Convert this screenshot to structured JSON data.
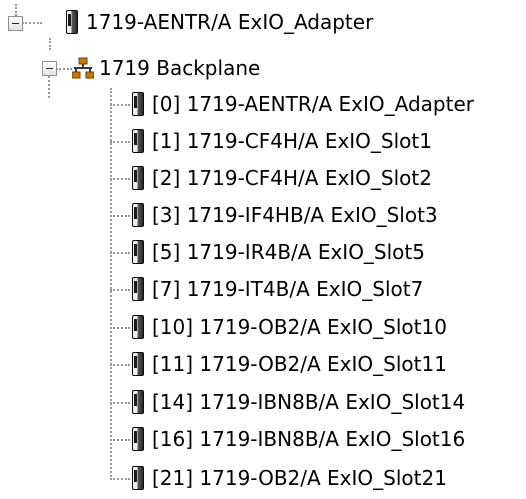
{
  "tree": {
    "root": {
      "label": "1719-AENTR/A ExIO_Adapter",
      "icon": "module-icon",
      "expanded": true
    },
    "backplane": {
      "label": "1719 Backplane",
      "icon": "network-icon",
      "expanded": true
    },
    "modules": [
      {
        "label": "[0] 1719-AENTR/A ExIO_Adapter",
        "icon": "module-icon"
      },
      {
        "label": "[1] 1719-CF4H/A ExIO_Slot1",
        "icon": "module-icon"
      },
      {
        "label": "[2] 1719-CF4H/A ExIO_Slot2",
        "icon": "module-icon"
      },
      {
        "label": "[3] 1719-IF4HB/A ExIO_Slot3",
        "icon": "module-icon"
      },
      {
        "label": "[5] 1719-IR4B/A ExIO_Slot5",
        "icon": "module-icon"
      },
      {
        "label": "[7] 1719-IT4B/A ExIO_Slot7",
        "icon": "module-icon"
      },
      {
        "label": "[10] 1719-OB2/A ExIO_Slot10",
        "icon": "module-icon"
      },
      {
        "label": "[11] 1719-OB2/A ExIO_Slot11",
        "icon": "module-icon"
      },
      {
        "label": "[14] 1719-IBN8B/A ExIO_Slot14",
        "icon": "module-icon"
      },
      {
        "label": "[16] 1719-IBN8B/A ExIO_Slot16",
        "icon": "module-icon"
      },
      {
        "label": "[21] 1719-OB2/A ExIO_Slot21",
        "icon": "module-icon"
      }
    ],
    "colors": {
      "connector": "#9a9a9a",
      "text": "#000000",
      "network_icon": "#c87800"
    }
  }
}
